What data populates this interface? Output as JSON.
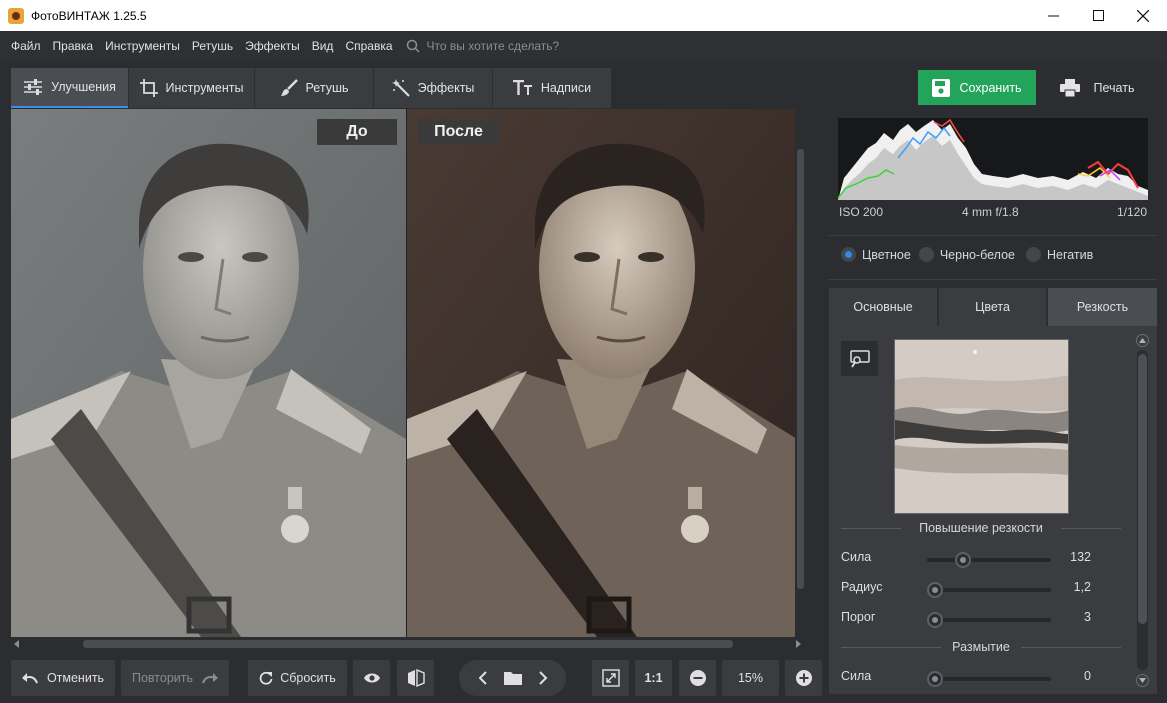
{
  "window": {
    "title": "ФотоВИНТАЖ 1.25.5"
  },
  "menu": {
    "items": [
      "Файл",
      "Правка",
      "Инструменты",
      "Ретушь",
      "Эффекты",
      "Вид",
      "Справка"
    ],
    "search_placeholder": "Что вы хотите сделать?"
  },
  "tabs": {
    "items": [
      {
        "label": "Улучшения",
        "icon": "sliders-icon",
        "active": true
      },
      {
        "label": "Инструменты",
        "icon": "crop-icon",
        "active": false
      },
      {
        "label": "Ретушь",
        "icon": "brush-icon",
        "active": false
      },
      {
        "label": "Эффекты",
        "icon": "magic-wand-icon",
        "active": false
      },
      {
        "label": "Надписи",
        "icon": "text-icon",
        "active": false
      }
    ]
  },
  "actions": {
    "save_label": "Сохранить",
    "print_label": "Печать",
    "save_color": "#22a45a"
  },
  "canvas": {
    "before_label": "До",
    "after_label": "После"
  },
  "bottom": {
    "undo_label": "Отменить",
    "redo_label": "Повторить",
    "reset_label": "Сбросить",
    "zoom_one_label": "1:1",
    "zoom_value": "15%"
  },
  "histogram": {
    "iso": "ISO 200",
    "lens": "4 mm f/1.8",
    "shutter": "1/120"
  },
  "color_mode": {
    "options": [
      {
        "label": "Цветное",
        "selected": true
      },
      {
        "label": "Черно-белое",
        "selected": false
      },
      {
        "label": "Негатив",
        "selected": false
      }
    ]
  },
  "subtabs": {
    "items": [
      {
        "label": "Основные",
        "active": false
      },
      {
        "label": "Цвета",
        "active": false
      },
      {
        "label": "Резкость",
        "active": true
      }
    ]
  },
  "sharpness": {
    "section_title": "Повышение резкости",
    "strength_label": "Сила",
    "strength_value": "132",
    "strength_fraction": 0.26,
    "radius_label": "Радиус",
    "radius_value": "1,2",
    "radius_fraction": 0.0,
    "threshold_label": "Порог",
    "threshold_value": "3",
    "threshold_fraction": 0.0
  },
  "blur": {
    "section_title": "Размытие",
    "strength_label": "Сила",
    "strength_value": "0",
    "strength_fraction": 0.0
  }
}
